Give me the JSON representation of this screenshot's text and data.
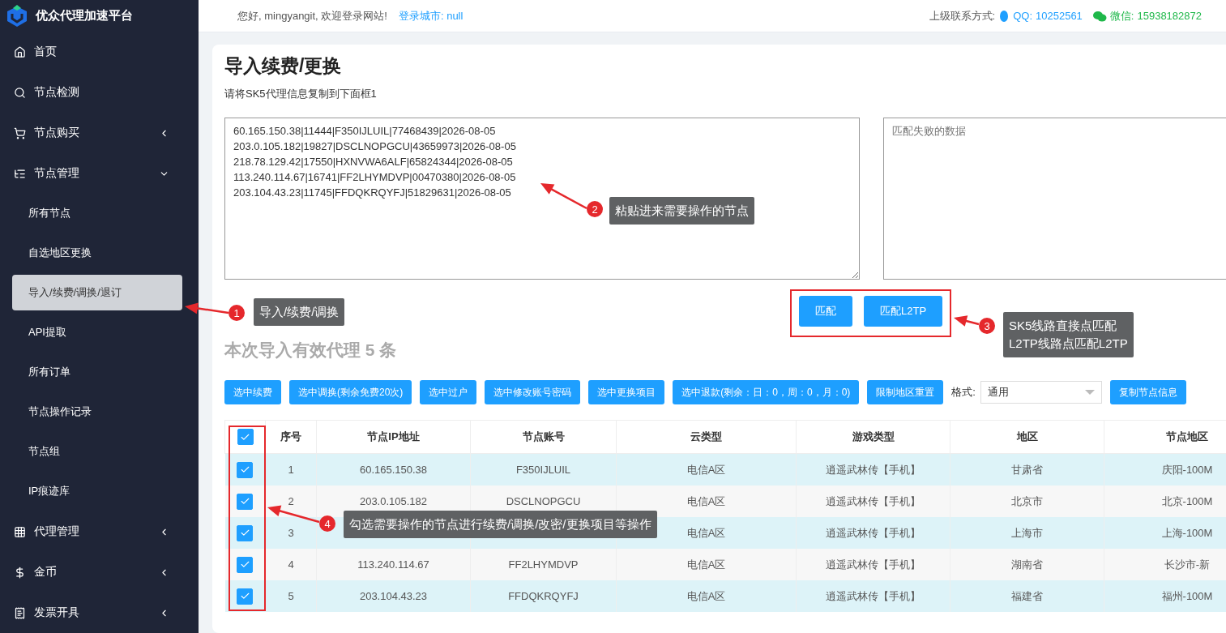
{
  "brand": {
    "name": "优众代理加速平台"
  },
  "header": {
    "greeting": "您好, mingyangit, 欢迎登录网站!",
    "city_link": "登录城市: null",
    "contact_label": "上级联系方式:",
    "qq_label": "QQ:",
    "qq_value": "10252561",
    "wechat_label": "微信:",
    "wechat_value": "15938182872"
  },
  "sidebar": {
    "items": [
      {
        "label": "首页"
      },
      {
        "label": "节点检测"
      },
      {
        "label": "节点购买",
        "expanded": false
      },
      {
        "label": "节点管理",
        "expanded": true,
        "children": [
          {
            "label": "所有节点",
            "selected": false
          },
          {
            "label": "自选地区更换",
            "selected": false
          },
          {
            "label": "导入/续费/调换/退订",
            "selected": true
          },
          {
            "label": "API提取",
            "selected": false
          },
          {
            "label": "所有订单",
            "selected": false
          },
          {
            "label": "节点操作记录",
            "selected": false
          },
          {
            "label": "节点组",
            "selected": false
          },
          {
            "label": "IP痕迹库",
            "selected": false
          }
        ]
      },
      {
        "label": "代理管理",
        "expanded": false
      },
      {
        "label": "金币",
        "expanded": false
      },
      {
        "label": "发票开具",
        "expanded": false
      }
    ]
  },
  "card": {
    "title": "导入续费/更换",
    "instruction": "请将SK5代理信息复制到下面框1",
    "input_box": {
      "value": "60.165.150.38|11444|F350IJLUIL|77468439|2026-08-05\n203.0.105.182|19827|DSCLNOPGCU|43659973|2026-08-05\n218.78.129.42|17550|HXNVWA6ALF|65824344|2026-08-05\n113.240.114.67|16741|FF2LHYMDVP|00470380|2026-08-05\n203.104.43.23|11745|FFDQKRQYFJ|51829631|2026-08-05"
    },
    "failed_box": {
      "placeholder": "匹配失败的数据"
    },
    "match_buttons": [
      "匹配",
      "匹配L2TP"
    ],
    "count_text": "本次导入有效代理 **5** 条",
    "action_buttons": [
      "选中续费",
      "选中调换(剩余免费20次)",
      "选中过户",
      "选中修改账号密码",
      "选中更换项目",
      "选中退款(剩余：日：0，周：0，月：0)",
      "限制地区重置"
    ],
    "format_label": "格式:",
    "format_select": {
      "value": "通用"
    },
    "copy_button": "复制节点信息",
    "table": {
      "header_checked": true,
      "columns": [
        "序号",
        "节点IP地址",
        "节点账号",
        "云类型",
        "游戏类型",
        "地区",
        "节点地区"
      ],
      "rows": [
        {
          "checked": true,
          "cells": [
            "1",
            "60.165.150.38",
            "F350IJLUIL",
            "电信A区",
            "逍遥武林传【手机】",
            "甘肃省",
            "庆阳-100M"
          ]
        },
        {
          "checked": true,
          "cells": [
            "2",
            "203.0.105.182",
            "DSCLNOPGCU",
            "电信A区",
            "逍遥武林传【手机】",
            "北京市",
            "北京-100M"
          ]
        },
        {
          "checked": true,
          "cells": [
            "3",
            null,
            null,
            "电信A区",
            "逍遥武林传【手机】",
            "上海市",
            "上海-100M"
          ]
        },
        {
          "checked": true,
          "cells": [
            "4",
            "113.240.114.67",
            "FF2LHYMDVP",
            "电信A区",
            "逍遥武林传【手机】",
            "湖南省",
            "长沙市-新"
          ]
        },
        {
          "checked": true,
          "cells": [
            "5",
            "203.104.43.23",
            "FFDQKRQYFJ",
            "电信A区",
            "逍遥武林传【手机】",
            "福建省",
            "福州-100M"
          ]
        }
      ]
    }
  },
  "annotations": [
    {
      "number": "1",
      "text": "导入/续费/调换"
    },
    {
      "number": "2",
      "text": "粘贴进来需要操作的节点"
    },
    {
      "number": "3",
      "text": "SK5线路直接点匹配\nL2TP线路点匹配L2TP"
    },
    {
      "number": "4",
      "text": "勾选需要操作的节点进行续费/调换/改密/更换项目等操作"
    }
  ]
}
